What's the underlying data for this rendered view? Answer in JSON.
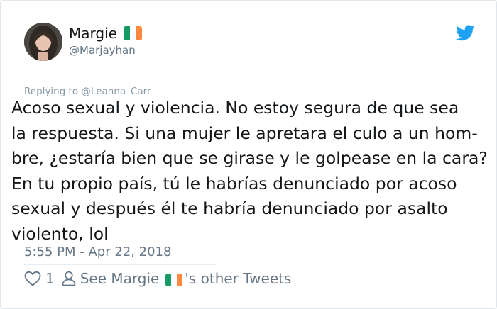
{
  "author": {
    "name": "Margie",
    "handle": "@Marjayhan",
    "flag_colors": [
      "#169b62",
      "#ffffff",
      "#ff883e"
    ]
  },
  "reply": {
    "prefix": "Replying to",
    "target": "@Leanna_Carr"
  },
  "tweet": {
    "text": "Acoso sexual y violencia. No estoy segura de que sea\nla respuesta. Si una mujer le apretara el culo a un hom-\nbre, ¿estaría bien que se girase y le golpease en la cara?\nEn tu propio país, tú le habrías denunciado por acoso\nsexual y después él te habría denunciado por asalto\nviolento, lol",
    "timestamp": "5:55 PM - Apr 22, 2018"
  },
  "actions": {
    "like_count": "1",
    "see_prefix": "See Margie",
    "see_suffix": "'s other Tweets"
  },
  "icons": {
    "logo": "twitter-bird-icon",
    "like": "heart-icon",
    "profile": "person-icon"
  },
  "colors": {
    "brand": "#1da1f2",
    "secondary_text": "#657786"
  }
}
